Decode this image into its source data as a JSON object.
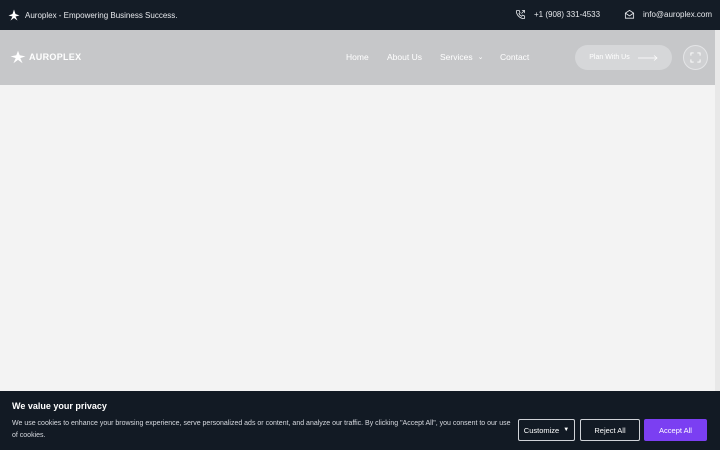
{
  "topbar": {
    "tagline": "Auroplex - Empowering Business Success.",
    "phone": "+1 (908) 331-4533",
    "email": "info@auroplex.com"
  },
  "nav": {
    "logo_text": "AUROPLEX",
    "items": [
      {
        "label": "Home"
      },
      {
        "label": "About Us"
      },
      {
        "label": "Services"
      },
      {
        "label": "Contact"
      }
    ],
    "cta_label": "Plan With Us"
  },
  "cookie": {
    "title": "We value your privacy",
    "text": "We use cookies to enhance your browsing experience, serve personalized ads or content, and analyze our traffic. By clicking \"Accept All\", you consent to our use of cookies.",
    "customize_label": "Customize",
    "reject_label": "Reject All",
    "accept_label": "Accept All"
  },
  "colors": {
    "topbar_bg": "#141c26",
    "nav_bg": "#c6c7c9",
    "page_bg": "#f3f3f3",
    "accent": "#7b3ff2"
  },
  "icons": [
    "star-logo-icon",
    "phone-icon",
    "mail-icon",
    "chevron-down-icon",
    "arrow-right-icon",
    "expand-icon",
    "caret-down-icon"
  ]
}
